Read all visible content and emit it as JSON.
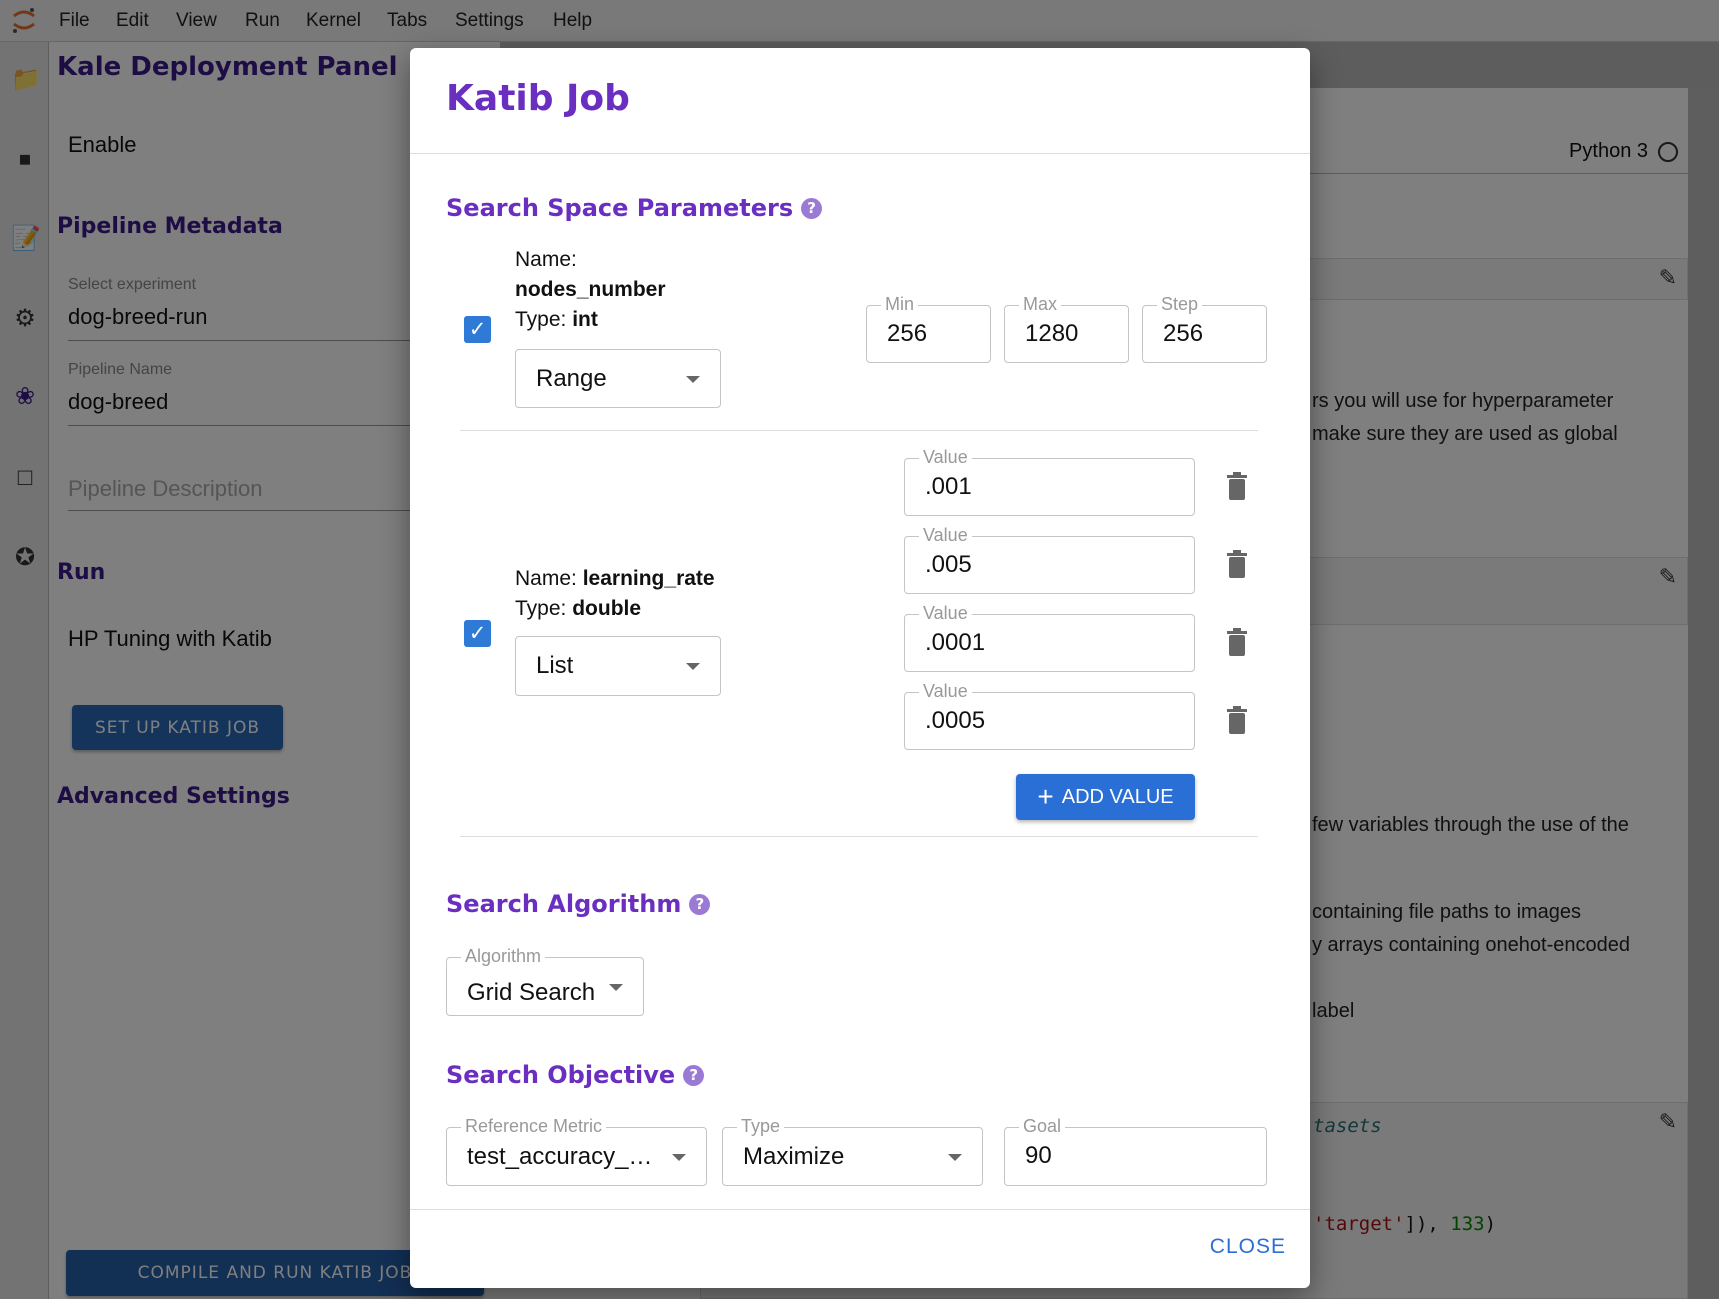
{
  "menubar": {
    "items": [
      "File",
      "Edit",
      "View",
      "Run",
      "Kernel",
      "Tabs",
      "Settings",
      "Help"
    ]
  },
  "iconbar": {
    "icons": [
      "folder-icon",
      "stop-circle-icon",
      "property-inspector-icon",
      "gear-icon",
      "kale-leaf-icon",
      "window-icon",
      "puzzle-icon"
    ]
  },
  "left_panel": {
    "title": "Kale Deployment Panel",
    "enable_label": "Enable",
    "metadata_heading": "Pipeline Metadata",
    "experiment_label": "Select experiment",
    "experiment_value": "dog-breed-run",
    "pipeline_name_label": "Pipeline Name",
    "pipeline_name_value": "dog-breed",
    "pipeline_description_placeholder": "Pipeline Description",
    "run_heading": "Run",
    "hp_tuning_label": "HP Tuning with Katib",
    "setup_button": "SET UP KATIB JOB",
    "advanced_heading": "Advanced Settings",
    "compile_button": "COMPILE AND RUN KATIB JOB"
  },
  "notebook": {
    "kernel": "Python 3",
    "text_lines": [
      "rs you will use for hyperparameter",
      "make sure they are used as global",
      "few variables through the use of the",
      "containing file paths to images",
      "y arrays containing onehot-encoded",
      "label"
    ],
    "code_comment": "tasets",
    "code_string": "'target'",
    "code_punct": "]), ",
    "code_number": "133",
    "code_close": ")"
  },
  "modal": {
    "title": "Katib Job",
    "search_space_heading": "Search Space Parameters",
    "params": [
      {
        "checked": true,
        "name_label": "Name:",
        "name": "nodes_number",
        "type_label": "Type:",
        "type": "int",
        "mode": "Range",
        "min_label": "Min",
        "min": "256",
        "max_label": "Max",
        "max": "1280",
        "step_label": "Step",
        "step": "256"
      },
      {
        "checked": true,
        "name_label": "Name:",
        "name": "learning_rate",
        "type_label": "Type:",
        "type": "double",
        "mode": "List",
        "value_label": "Value",
        "values": [
          ".001",
          ".005",
          ".0001",
          ".0005"
        ]
      }
    ],
    "add_value_button": "ADD VALUE",
    "algorithm_heading": "Search Algorithm",
    "algorithm_label": "Algorithm",
    "algorithm_value": "Grid Search",
    "objective_heading": "Search Objective",
    "reference_metric_label": "Reference Metric",
    "reference_metric_value": "test_accuracy_…",
    "type_label": "Type",
    "type_value": "Maximize",
    "goal_label": "Goal",
    "goal_value": "90",
    "close_button": "CLOSE"
  },
  "colors": {
    "accent": "#6a2fc0",
    "primary_button": "#2a6fd6",
    "checkbox": "#2e7ad6",
    "kale_heading": "#3d1a8a"
  }
}
